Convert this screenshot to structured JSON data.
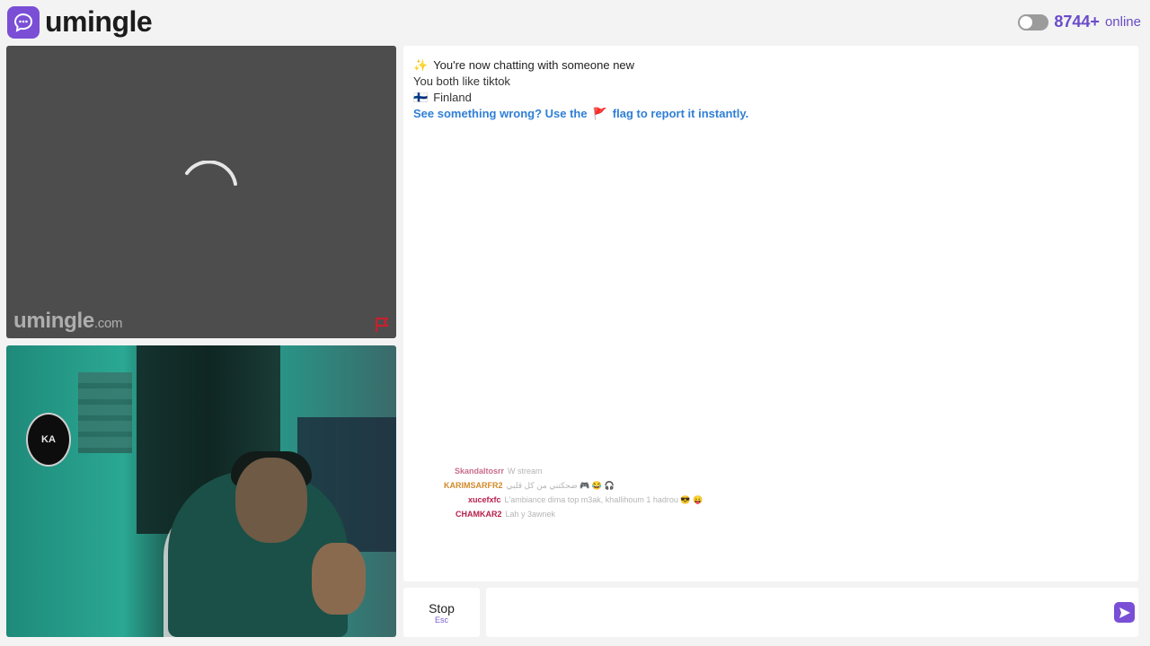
{
  "header": {
    "logo_text": "umingle",
    "online_count": "8744+",
    "online_label": "online"
  },
  "remote_video": {
    "watermark_brand": "umingle",
    "watermark_domain": ".com",
    "emblem_text": "KA"
  },
  "chat": {
    "lines": [
      {
        "icon": "✨",
        "text": "You're now chatting with someone new"
      },
      {
        "icon": "",
        "text": "You both like tiktok"
      },
      {
        "icon": "🇫🇮",
        "text": "Finland"
      }
    ],
    "report_hint_before": "See something wrong? Use the",
    "report_hint_icon": "🚩",
    "report_hint_after": "flag to report it instantly."
  },
  "overlay_chat": [
    {
      "name": "Skandaltosrr",
      "message": "W stream",
      "color": "#c96d8c"
    },
    {
      "name": "KARIMSARFR2",
      "message": "ضحكتني من كل قلبي 🎮 😂 🎧",
      "color": "#d08a2a"
    },
    {
      "name": "xucefxfc",
      "message": "L'ambiance dima top m3ak, khallihoum 1 hadrou 😎 😛",
      "color": "#b81f4c"
    },
    {
      "name": "CHAMKAR2",
      "message": "Lah y 3awnek",
      "color": "#b81f4c"
    }
  ],
  "controls": {
    "stop_label": "Stop",
    "stop_hint": "Esc",
    "message_placeholder": ""
  },
  "colors": {
    "accent": "#7a4fd6",
    "report_link": "#2f7fd6",
    "report_flag": "#c8202f"
  }
}
